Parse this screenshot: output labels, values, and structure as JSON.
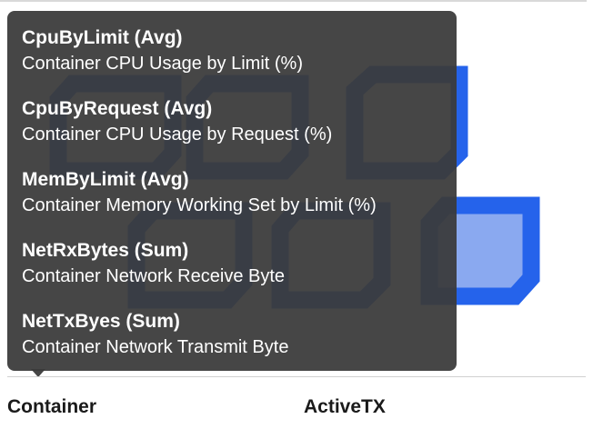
{
  "tooltip": {
    "metrics": [
      {
        "title": "CpuByLimit (Avg)",
        "description": "Container CPU Usage by Limit (%)"
      },
      {
        "title": "CpuByRequest (Avg)",
        "description": "Container CPU Usage by Request (%)"
      },
      {
        "title": "MemByLimit (Avg)",
        "description": "Container Memory Working Set by Limit (%)"
      },
      {
        "title": "NetRxBytes (Sum)",
        "description": "Container Network Receive Byte"
      },
      {
        "title": "NetTxByes (Sum)",
        "description": "Container Network Transmit Byte"
      }
    ]
  },
  "table": {
    "columns": [
      "Container",
      "ActiveTX"
    ]
  },
  "colors": {
    "hex_stroke": "#2563eb",
    "hex_fill_light": "#8aa9f0",
    "tooltip_bg": "#3a3a3a"
  }
}
